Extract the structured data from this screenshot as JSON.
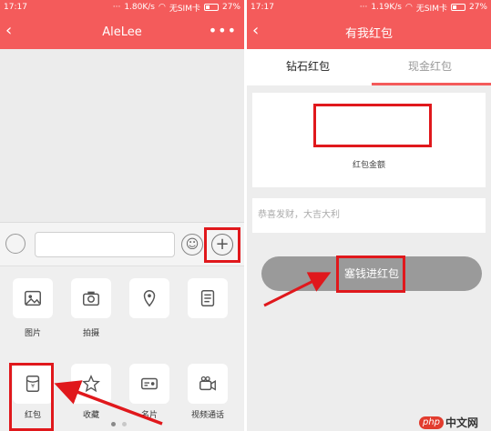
{
  "left_screen": {
    "status": {
      "time": "17:17",
      "speed": "1.80K/s",
      "sim": "无SIM卡",
      "battery": "27%"
    },
    "title": "AleLee",
    "back_icon": "chevron-left-icon",
    "more_icon": "more-dots-icon",
    "plus_symbol": "+",
    "emoji_symbol": "☺",
    "panel_items": [
      {
        "label": "图片",
        "icon": "image-icon"
      },
      {
        "label": "拍摄",
        "icon": "camera-icon"
      },
      {
        "label": "",
        "icon": "location-icon"
      },
      {
        "label": "",
        "icon": "document-icon"
      },
      {
        "label": "红包",
        "icon": "red-envelope-icon"
      },
      {
        "label": "收藏",
        "icon": "star-icon"
      },
      {
        "label": "名片",
        "icon": "card-icon"
      },
      {
        "label": "视频通话",
        "icon": "video-call-icon"
      }
    ]
  },
  "right_screen": {
    "status": {
      "time": "17:17",
      "speed": "1.19K/s",
      "sim": "无SIM卡",
      "battery": "27%"
    },
    "title": "有我红包",
    "tabs": [
      {
        "label": "钻石红包"
      },
      {
        "label": "现金红包"
      }
    ],
    "amount_label": "红包金额",
    "greeting": "恭喜发财，大吉大利",
    "submit_label": "塞钱进红包"
  },
  "watermark": {
    "logo": "php",
    "text": "中文网"
  },
  "colors": {
    "brand_red": "#f45b5b",
    "highlight_red": "#e0181c",
    "button_gray": "#9a9a9a"
  }
}
